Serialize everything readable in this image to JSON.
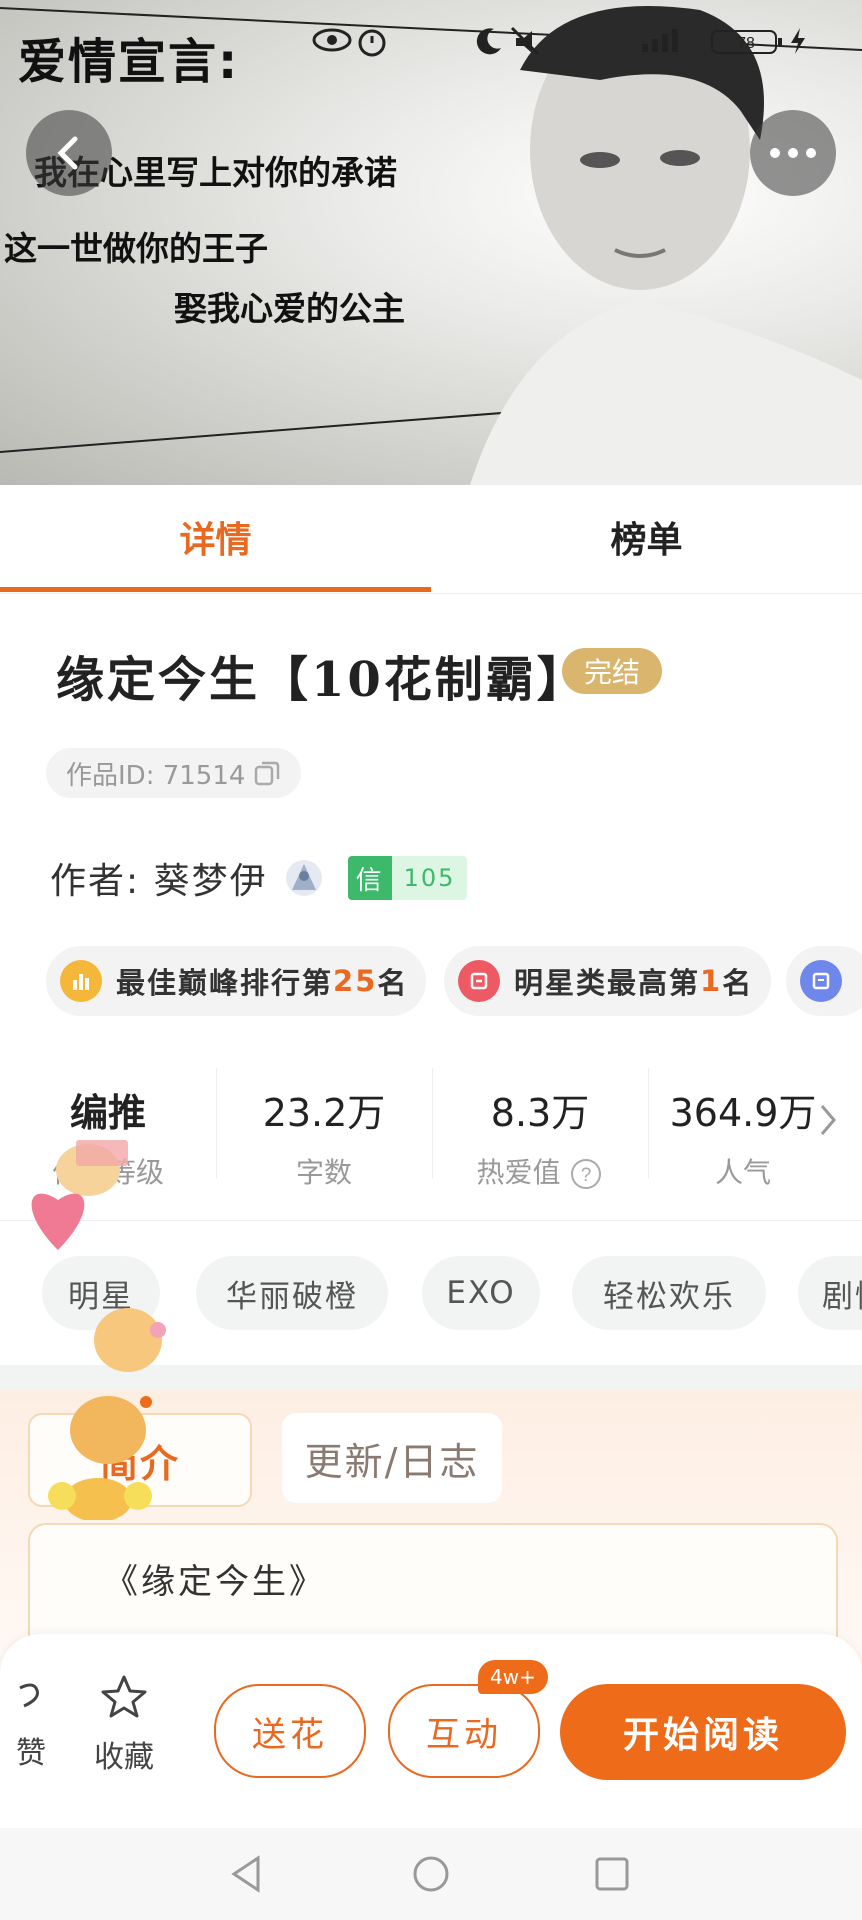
{
  "cover": {
    "title": "爱情宣言:",
    "lines": [
      "我在心里写上对你的承诺",
      "这一世做你的王子",
      "娶我心爱的公主"
    ]
  },
  "status_bar": {
    "battery": "78"
  },
  "tabs": [
    {
      "label": "详情",
      "active": true
    },
    {
      "label": "榜单",
      "active": false
    }
  ],
  "book": {
    "title": "缘定今生【10花制霸】",
    "status_badge": "完结",
    "work_id": "作品ID: 71514",
    "author_label": "作者: 葵梦伊",
    "xin_label": "信",
    "xin_value": "105"
  },
  "rankings": [
    {
      "prefix": "最佳巅峰排行第",
      "number": "25",
      "suffix": "名",
      "color": "#f4b73a"
    },
    {
      "prefix": "明星类最高第",
      "number": "1",
      "suffix": "名",
      "color": "#ee5a63"
    },
    {
      "prefix": "",
      "number": "",
      "suffix": "",
      "color": "#6f86ea"
    }
  ],
  "stats": [
    {
      "value": "编推",
      "label": "作品等级"
    },
    {
      "value": "23.2万",
      "label": "字数"
    },
    {
      "value": "8.3万",
      "label": "热爱值"
    },
    {
      "value": "364.9万",
      "label": "人气"
    }
  ],
  "tags": [
    "明星",
    "华丽破橙",
    "EXO",
    "轻松欢乐",
    "剧情"
  ],
  "intro": {
    "tab_active": "简介",
    "tab_idle": "更新/日志",
    "text": "《缘定今生》"
  },
  "actions": {
    "like": "赞",
    "favorite": "收藏",
    "send_flower": "送花",
    "interact": "互动",
    "interact_count": "4w+",
    "start_reading": "开始阅读"
  },
  "colors": {
    "accent": "#e8691f",
    "done_badge": "#d9b56e",
    "xin_green": "#3cb96a"
  }
}
